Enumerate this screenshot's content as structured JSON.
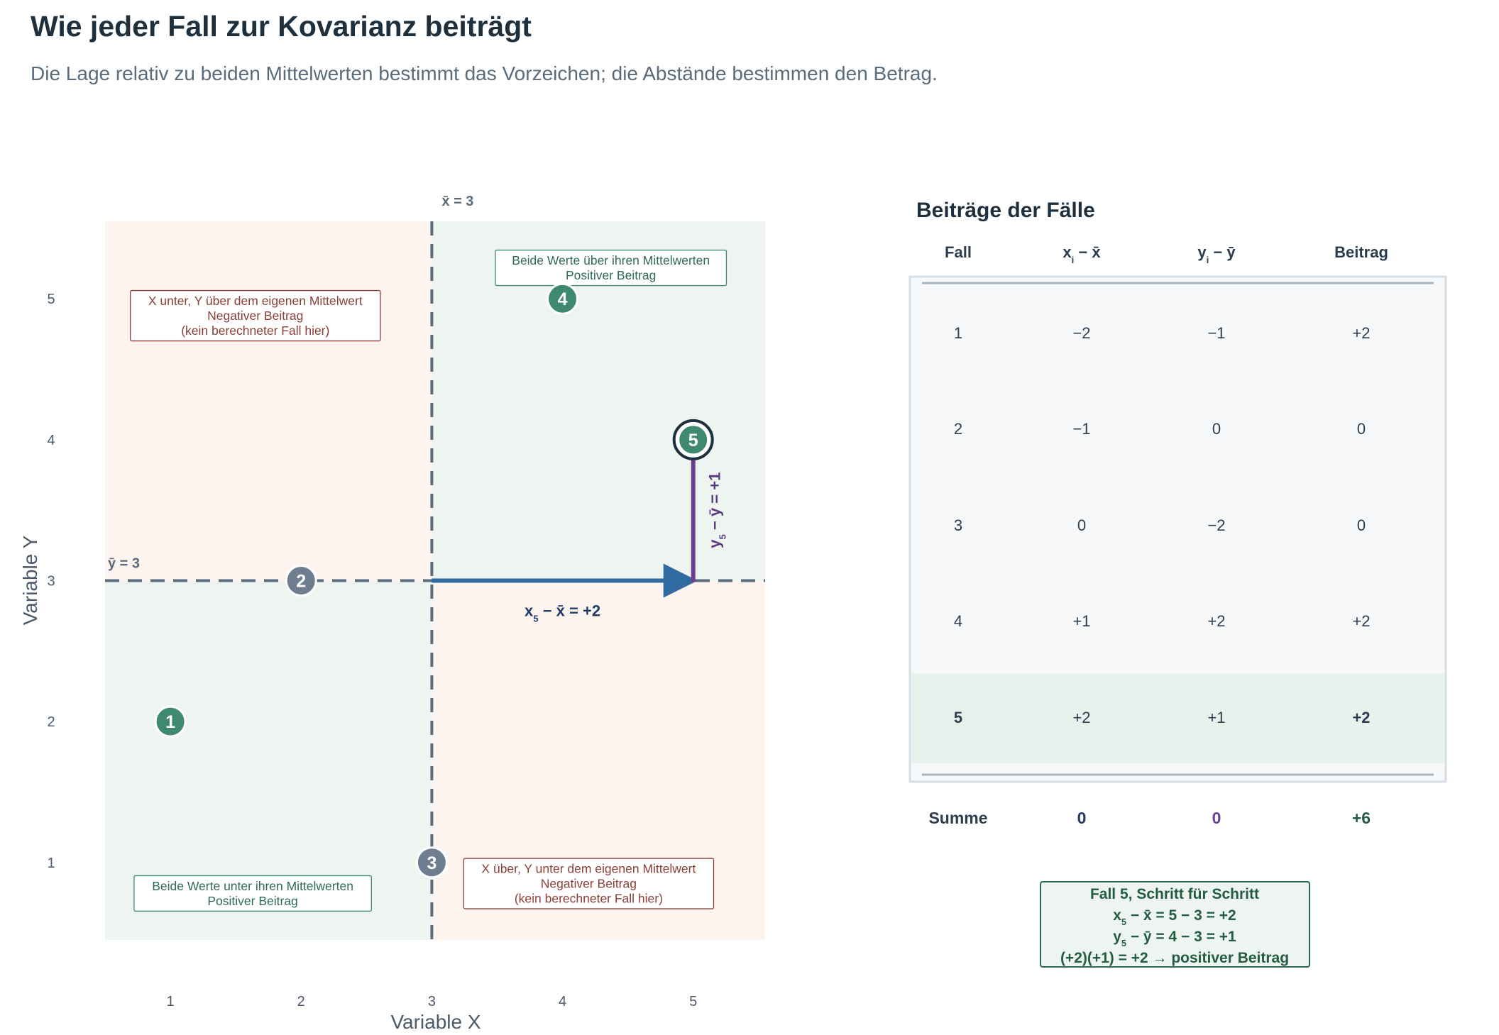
{
  "title": "Wie jeder Fall zur Kovarianz beiträgt",
  "subtitle": "Die Lage relativ zu beiden Mittelwerten bestimmt das Vorzeichen; die Abstände bestimmen den Betrag.",
  "colors": {
    "positive": "#3f8a6e",
    "positive_bg": "#eef5f1",
    "negative_bg": "#fdf3ef",
    "negative_text": "#8a3f36",
    "neutral_point": "#6e7e8e",
    "mean_line": "#5c6e7e",
    "x_deviation": "#2f6aa0",
    "y_deviation": "#6a3f90",
    "dark": "#1e2f3e"
  },
  "chart_data": {
    "type": "scatter",
    "xlabel": "Variable X",
    "ylabel": "Variable Y",
    "xlim": [
      0.5,
      5.55
    ],
    "ylim": [
      0.45,
      5.55
    ],
    "xticks": [
      1,
      2,
      3,
      4,
      5
    ],
    "yticks": [
      1,
      2,
      3,
      4,
      5
    ],
    "grid": false,
    "mean_x": 3,
    "mean_y": 3,
    "mean_x_label": "x̄ = 3",
    "mean_y_label": "ȳ = 3",
    "points": [
      {
        "label": "1",
        "x": 1,
        "y": 2,
        "kind": "positive"
      },
      {
        "label": "2",
        "x": 2,
        "y": 3,
        "kind": "zero"
      },
      {
        "label": "3",
        "x": 3,
        "y": 1,
        "kind": "zero"
      },
      {
        "label": "4",
        "x": 4,
        "y": 5,
        "kind": "positive"
      },
      {
        "label": "5",
        "x": 5,
        "y": 4,
        "kind": "positive",
        "highlight": true
      }
    ],
    "quadrants": [
      {
        "position": "top-right",
        "kind": "positive",
        "lines": [
          "Beide Werte über ihren Mittelwerten",
          "Positiver Beitrag"
        ]
      },
      {
        "position": "top-left",
        "kind": "negative",
        "lines": [
          "X unter, Y über dem eigenen Mittelwert",
          "Negativer Beitrag",
          "(kein berechneter Fall hier)"
        ]
      },
      {
        "position": "bottom-left",
        "kind": "positive",
        "lines": [
          "Beide Werte unter ihren Mittelwerten",
          "Positiver Beitrag"
        ]
      },
      {
        "position": "bottom-right",
        "kind": "negative",
        "lines": [
          "X über, Y unter dem eigenen Mittelwert",
          "Negativer Beitrag",
          "(kein berechneter Fall hier)"
        ]
      }
    ],
    "deviations": {
      "case": "5",
      "x_label": {
        "base": "x",
        "sub": "5",
        "rest": " − x̄ = +2"
      },
      "y_label": {
        "base": "y",
        "sub": "5",
        "rest": " − ȳ = +1"
      }
    }
  },
  "table": {
    "title": "Beiträge der Fälle",
    "headers": [
      {
        "base": "Fall"
      },
      {
        "base": "x",
        "sub": "i",
        "rest": " − x̄"
      },
      {
        "base": "y",
        "sub": "i",
        "rest": " − ȳ"
      },
      {
        "base": "Beitrag"
      }
    ],
    "rows": [
      {
        "fall": "1",
        "dx": "−2",
        "dy": "−1",
        "beitrag": "+2"
      },
      {
        "fall": "2",
        "dx": "−1",
        "dy": "0",
        "beitrag": "0"
      },
      {
        "fall": "3",
        "dx": "0",
        "dy": "−2",
        "beitrag": "0"
      },
      {
        "fall": "4",
        "dx": "+1",
        "dy": "+2",
        "beitrag": "+2"
      },
      {
        "fall": "5",
        "dx": "+2",
        "dy": "+1",
        "beitrag": "+2",
        "highlight": true
      }
    ],
    "sum": {
      "label": "Summe",
      "dx": "0",
      "dy": "0",
      "beitrag": "+6"
    }
  },
  "stepbox": {
    "title": "Fall 5, Schritt für Schritt",
    "line1": {
      "base": "x",
      "sub": "5",
      "rest": " − x̄ = 5 − 3 = +2"
    },
    "line2": {
      "base": "y",
      "sub": "5",
      "rest": " − ȳ = 4 − 3 = +1"
    },
    "line3": "(+2)(+1) = +2  →  positiver Beitrag"
  }
}
